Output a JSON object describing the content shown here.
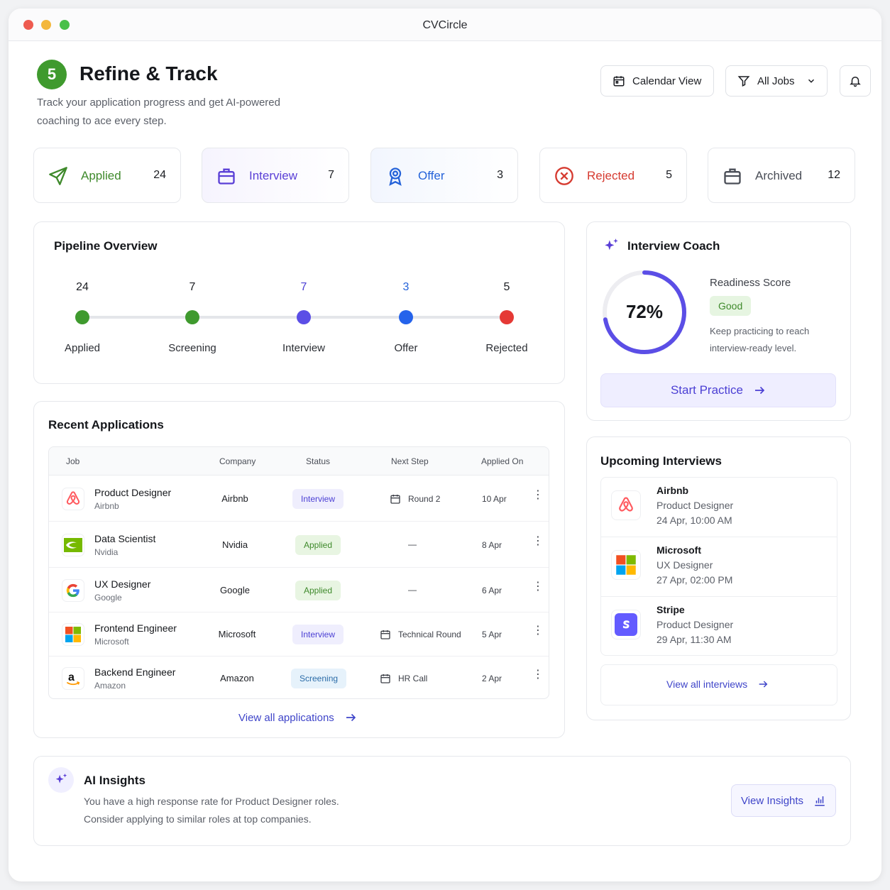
{
  "window": {
    "title": "CVCircle"
  },
  "header": {
    "step": "5",
    "title": "Refine & Track",
    "subtitle": "Track your application progress and get AI-powered coaching to ace every step.",
    "calendar_label": "Calendar View",
    "filter_label": "All Jobs"
  },
  "status_cards": [
    {
      "label": "Applied",
      "count": "24",
      "color": "#3f8a2c"
    },
    {
      "label": "Interview",
      "count": "7",
      "color": "#5a3fd6"
    },
    {
      "label": "Offer",
      "count": "3",
      "color": "#2563d9"
    },
    {
      "label": "Rejected",
      "count": "5",
      "color": "#d63b31"
    },
    {
      "label": "Archived",
      "count": "12",
      "color": "#4a4e57"
    }
  ],
  "pipeline": {
    "title": "Pipeline Overview",
    "stages": [
      {
        "name": "Applied",
        "count": "24",
        "color": "#3f9a2e",
        "count_color": "#1b1d22"
      },
      {
        "name": "Screening",
        "count": "7",
        "color": "#3f9a2e",
        "count_color": "#1b1d22"
      },
      {
        "name": "Interview",
        "count": "7",
        "color": "#5b4ee6",
        "count_color": "#4b3fd4"
      },
      {
        "name": "Offer",
        "count": "3",
        "color": "#2563eb",
        "count_color": "#2563d9"
      },
      {
        "name": "Rejected",
        "count": "5",
        "color": "#e53935",
        "count_color": "#1b1d22"
      }
    ]
  },
  "coach": {
    "title": "Interview Coach",
    "score_label": "Readiness Score",
    "score_value": "72%",
    "score_fraction": 0.72,
    "badge": "Good",
    "note": "Keep practicing to reach interview-ready level.",
    "cta": "Start Practice"
  },
  "recent": {
    "title": "Recent Applications",
    "columns": [
      "Job",
      "Company",
      "Status",
      "Next Step",
      "Applied On"
    ],
    "rows": [
      {
        "job": "Product Designer",
        "company_sub": "Airbnb",
        "company": "Airbnb",
        "status": "Interview",
        "status_kind": "interview",
        "next": "Round 2",
        "applied": "10 Apr",
        "logo": "airbnb-logo"
      },
      {
        "job": "Data Scientist",
        "company_sub": "Nvidia",
        "company": "Nvidia",
        "status": "Applied",
        "status_kind": "applied",
        "next": "—",
        "applied": "8 Apr",
        "logo": "nvidia-logo"
      },
      {
        "job": "UX Designer",
        "company_sub": "Google",
        "company": "Google",
        "status": "Applied",
        "status_kind": "applied",
        "next": "—",
        "applied": "6 Apr",
        "logo": "google-logo"
      },
      {
        "job": "Frontend Engineer",
        "company_sub": "Microsoft",
        "company": "Microsoft",
        "status": "Interview",
        "status_kind": "interview",
        "next": "Technical Round",
        "applied": "5 Apr",
        "logo": "microsoft-logo"
      },
      {
        "job": "Backend Engineer",
        "company_sub": "Amazon",
        "company": "Amazon",
        "status": "Screening",
        "status_kind": "screening",
        "next": "HR Call",
        "applied": "2 Apr",
        "logo": "amazon-logo"
      }
    ],
    "view_all": "View all applications"
  },
  "upcoming": {
    "title": "Upcoming Interviews",
    "items": [
      {
        "company": "Airbnb",
        "role": "Product Designer",
        "time": "24 Apr, 10:00 AM",
        "logo": "airbnb-logo"
      },
      {
        "company": "Microsoft",
        "role": "UX Designer",
        "time": "27 Apr, 02:00 PM",
        "logo": "microsoft-logo"
      },
      {
        "company": "Stripe",
        "role": "Product Designer",
        "time": "29 Apr, 11:30 AM",
        "logo": "stripe-logo"
      }
    ],
    "view_all": "View all interviews"
  },
  "insights": {
    "title": "AI Insights",
    "line1": "You have a high response rate for Product Designer roles.",
    "line2": "Consider applying to similar roles at top companies.",
    "cta": "View Insights"
  }
}
